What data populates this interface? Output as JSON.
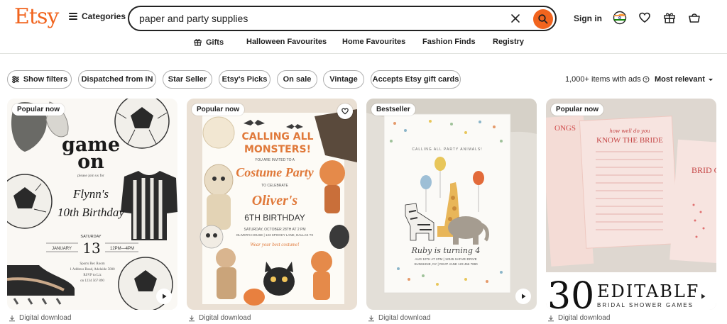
{
  "brand": {
    "logo": "Etsy",
    "accent": "#f1641e"
  },
  "header": {
    "categories_label": "Categories",
    "search_value": "paper and party supplies",
    "signin_label": "Sign in",
    "icons": [
      "india-flag-icon",
      "heart-icon",
      "gift-icon",
      "basket-icon"
    ]
  },
  "nav": {
    "items": [
      "Gifts",
      "Halloween Favourites",
      "Home Favourites",
      "Fashion Finds",
      "Registry"
    ]
  },
  "filters": {
    "chips": [
      "Show filters",
      "Dispatched from IN",
      "Star Seller",
      "Etsy's Picks",
      "On sale",
      "Vintage",
      "Accepts Etsy gift cards"
    ],
    "result_count": "1,000+ items with ads",
    "sort_label": "Most relevant"
  },
  "listings": [
    {
      "badge": "Popular now",
      "download_label": "Digital download",
      "art": {
        "line1": "game",
        "line2": "on",
        "invite": "please join us for",
        "name": "Flynn's",
        "event": "10th Birthday",
        "day": "SATURDAY",
        "month": "JANUARY",
        "date": "13",
        "time": "12PM—4PM",
        "address1": "Sports Rec Room",
        "address2": "1 Address Road, Adelaide 5000",
        "rsvp1": "RSVP to Liz",
        "rsvp2": "on 1234 567 890"
      }
    },
    {
      "badge": "Popular now",
      "download_label": "Digital download",
      "art": {
        "title1": "CALLING ALL",
        "title2": "MONSTERS!",
        "sub": "YOU ARE INVITED TO A",
        "title3": "Costume Party",
        "celebrate": "TO CELEBRATE",
        "name": "Oliver's",
        "event": "6TH BIRTHDAY",
        "when": "SATURDAY, OCTOBER 28TH AT 2 PM",
        "where": "OLIVER'S HOUSE | 123 SPOOKY LANE, DALLAS TX",
        "wear": "Wear your best costume!"
      }
    },
    {
      "badge": "Bestseller",
      "download_label": "Digital download",
      "art": {
        "top": "CALLING ALL PARTY ANIMALS!",
        "name": "Ruby is turning 4",
        "details1": "AUG 10TH AT 2PM | 12345 SAFARI DRIVE",
        "details2": "SUNSHINE, NY | RSVP JANE 123 456 7890"
      }
    },
    {
      "badge": "Popular now",
      "download_label": "Digital download",
      "art": {
        "sheet_title1": "how well do you",
        "sheet_title2": "KNOW THE BRIDE",
        "side_left": "ONGS",
        "side_right": "BRID GRO",
        "big_num": "30",
        "big_word": "EDITABLE",
        "caption": "BRIDAL SHOWER GAMES"
      }
    }
  ]
}
